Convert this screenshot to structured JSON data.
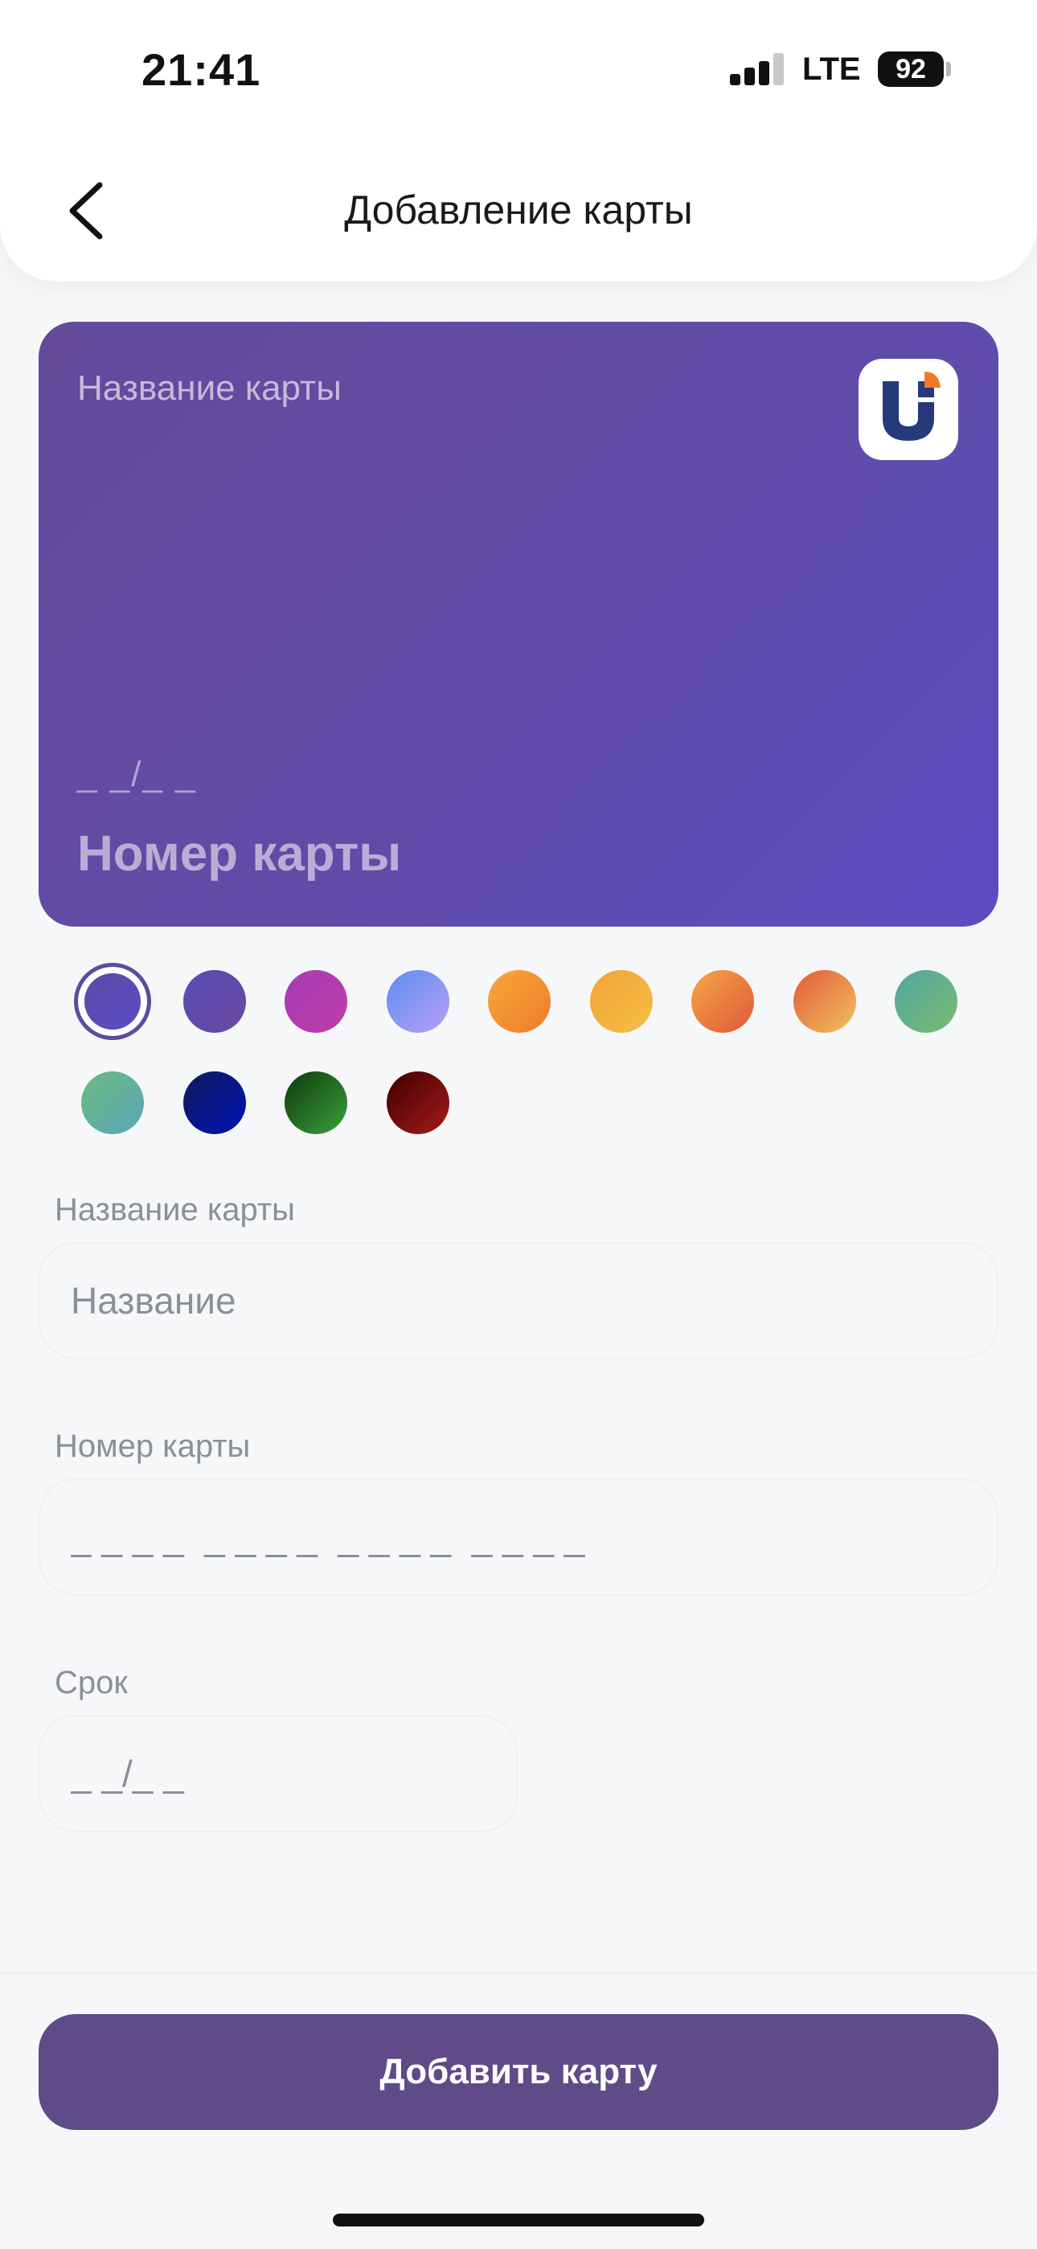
{
  "status_bar": {
    "time": "21:41",
    "network": "LTE",
    "battery": "92"
  },
  "header": {
    "title": "Добавление карты",
    "back_icon": "chevron-left-icon"
  },
  "card_preview": {
    "name": "Название карты",
    "expiry": "_ _/_ _",
    "number": "Номер карты",
    "logo_icon": "bank-logo-icon"
  },
  "colors": {
    "selected_index": 0,
    "swatches": [
      {
        "from": "#5e4aa8",
        "to": "#5a4cc4"
      },
      {
        "from": "#5a4bb6",
        "to": "#6a4aa0"
      },
      {
        "from": "#a43cb4",
        "to": "#c03ca8"
      },
      {
        "from": "#5b8ef5",
        "to": "#b89ff0"
      },
      {
        "from": "#f6a83a",
        "to": "#f07b2a"
      },
      {
        "from": "#f2a33a",
        "to": "#f5c143"
      },
      {
        "from": "#f3a743",
        "to": "#e2573d"
      },
      {
        "from": "#e25a3a",
        "to": "#f0c25c"
      },
      {
        "from": "#4fa7a0",
        "to": "#7cbb6f"
      },
      {
        "from": "#69bb7c",
        "to": "#5aa6bd"
      },
      {
        "from": "#0f1b5c",
        "to": "#0012b5"
      },
      {
        "from": "#0d3a0d",
        "to": "#3aa13a"
      },
      {
        "from": "#3d0000",
        "to": "#a81a1a"
      }
    ]
  },
  "form": {
    "name_label": "Название карты",
    "name_placeholder": "Название",
    "number_label": "Номер карты",
    "number_placeholder": "_ _ _ _  _ _ _ _  _ _ _ _  _ _ _ _",
    "expiry_label": "Срок",
    "expiry_placeholder": "_ _/_ _"
  },
  "submit_label": "Добавить карту"
}
